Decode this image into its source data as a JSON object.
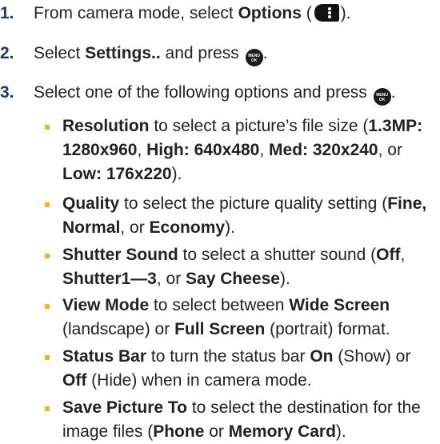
{
  "steps": [
    {
      "number": "1.",
      "pre": "From camera mode, select ",
      "bold": "Options",
      "post_open": " (",
      "icon": "options-softkey-icon",
      "post_close": ")."
    },
    {
      "number": "2.",
      "pre": "Select ",
      "bold": "Settings..",
      "post": " and press ",
      "icon": "menu-ok-icon",
      "end": "."
    },
    {
      "number": "3.",
      "text": "Select one of the following options and press ",
      "icon": "menu-ok-icon",
      "end": "."
    }
  ],
  "menu_icon": {
    "top": "MENU",
    "bottom": "OK"
  },
  "bullets": [
    {
      "parts": [
        {
          "t": "Resolution",
          "b": true
        },
        {
          "t": " to select a picture’s file size (",
          "b": false
        },
        {
          "t": "1.3MP: 1280x960",
          "b": true
        },
        {
          "t": ", ",
          "b": false
        },
        {
          "t": "High: 640x480",
          "b": true
        },
        {
          "t": ", ",
          "b": false
        },
        {
          "t": "Med: 320x240",
          "b": true
        },
        {
          "t": ", or ",
          "b": false
        },
        {
          "t": "Low: 176x220",
          "b": true
        },
        {
          "t": ").",
          "b": false
        }
      ]
    },
    {
      "parts": [
        {
          "t": "Quality",
          "b": true
        },
        {
          "t": " to select the picture quality setting (",
          "b": false
        },
        {
          "t": "Fine, Normal",
          "b": true
        },
        {
          "t": ", or ",
          "b": false
        },
        {
          "t": "Economy",
          "b": true
        },
        {
          "t": ").",
          "b": false
        }
      ]
    },
    {
      "parts": [
        {
          "t": "Shutter Sound",
          "b": true
        },
        {
          "t": " to select a shutter sound (",
          "b": false
        },
        {
          "t": "Off",
          "b": true
        },
        {
          "t": ", ",
          "b": false
        },
        {
          "t": "Shutter1—3",
          "b": true
        },
        {
          "t": ", or ",
          "b": false
        },
        {
          "t": "Say Cheese",
          "b": true
        },
        {
          "t": ").",
          "b": false
        }
      ]
    },
    {
      "parts": [
        {
          "t": "View Mode",
          "b": true
        },
        {
          "t": " to select between ",
          "b": false
        },
        {
          "t": "Wide Screen",
          "b": true
        },
        {
          "t": " (landscape) or ",
          "b": false
        },
        {
          "t": "Full Screen",
          "b": true
        },
        {
          "t": " (portrait) format.",
          "b": false
        }
      ]
    },
    {
      "parts": [
        {
          "t": "Status Bar",
          "b": true
        },
        {
          "t": " to turn the status bar ",
          "b": false
        },
        {
          "t": "On",
          "b": true
        },
        {
          "t": " (Show) or ",
          "b": false
        },
        {
          "t": "Off",
          "b": true
        },
        {
          "t": " (Hide) when in camera mode.",
          "b": false
        }
      ]
    },
    {
      "parts": [
        {
          "t": "Save Picture To",
          "b": true
        },
        {
          "t": " to select the destination for the image files (",
          "b": false
        },
        {
          "t": "Phone",
          "b": true
        },
        {
          "t": " or ",
          "b": false
        },
        {
          "t": "Memory Card",
          "b": true
        },
        {
          "t": ").",
          "b": false
        }
      ]
    }
  ]
}
